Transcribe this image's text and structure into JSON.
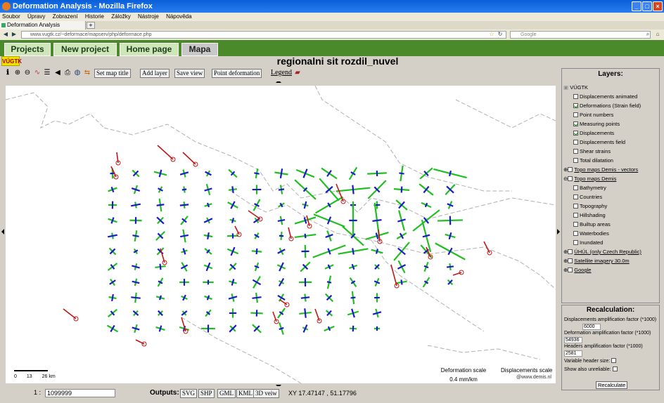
{
  "window": {
    "title": "Deformation Analysis - Mozilla Firefox"
  },
  "menu": [
    "Soubor",
    "Úpravy",
    "Zobrazení",
    "Historie",
    "Záložky",
    "Nástroje",
    "Nápověda"
  ],
  "browser_tab": {
    "label": "Deformation Analysis",
    "new_tab": "+"
  },
  "address": {
    "url": "www.vugtk.cz/~deformace/mapserv/php/deformace.php",
    "search_placeholder": "Google"
  },
  "nav": {
    "tabs": [
      "Projects",
      "New project",
      "Home page",
      "Mapa"
    ],
    "active": "Mapa"
  },
  "header": {
    "logo": "VÚGTK",
    "title": "regionalni sit rozdil_nuvel"
  },
  "toolbar": {
    "set_title": "Set map title",
    "add_layer": "Add layer",
    "save_view": "Save view",
    "point_deformation": "Point deformation",
    "legend": "Legend"
  },
  "map": {
    "scale_ticks": [
      "0",
      "13",
      "26 km"
    ],
    "deformation_scale_label": "Deformation scale",
    "deformation_scale_value": "0.4 mm/km",
    "displacements_scale_label": "Displacements scale",
    "copyright": "@www.demis.nl",
    "colors": {
      "strain_extension": "#1fbf1f",
      "strain_compression": "#1a1acc",
      "displacement": "#c01818",
      "border": "#b0b0b0"
    }
  },
  "layers": {
    "title": "Layers:",
    "root": "VÚGTK",
    "items": [
      {
        "label": "Displacements animated",
        "checked": false
      },
      {
        "label": "Deformations (Strain field)",
        "checked": true
      },
      {
        "label": "Point numbers",
        "checked": false
      },
      {
        "label": "Measuring points",
        "checked": true
      },
      {
        "label": "Displacements",
        "checked": true
      },
      {
        "label": "Displacements field",
        "checked": false
      },
      {
        "label": "Shear strains",
        "checked": false
      },
      {
        "label": "Total dilatation",
        "checked": false
      }
    ],
    "topo_vectors": "Topo maps Demis - vectors",
    "topo": "Topo maps Demis",
    "topo_items": [
      "Bathymetry",
      "Countries",
      "Topography",
      "Hillshading",
      "Builtup areas",
      "Waterbodies",
      "Inundated"
    ],
    "uhul": "ÚHÚL (only Czech Republic)",
    "satellite": "Satellite imagery 30.0m",
    "google": "Google"
  },
  "recalc": {
    "title": "Recalculation:",
    "disp_label": "Displacements amplification factor (*1000)",
    "disp_value": "6000",
    "def_label": "Deformation amplification factor (*1000)",
    "def_value": "54936",
    "head_label": "Headers amplification factor (*1000)",
    "head_value": "2581",
    "variable_header": "Variable header size:",
    "show_unreliable": "Show also unreliable:",
    "button": "Recalculate"
  },
  "status": {
    "scale_prefix": "1 :",
    "scale_value": "1099999",
    "outputs_label": "Outputs:",
    "outputs": [
      "SVG",
      "SHP",
      "GML",
      "KML",
      "3D veiw"
    ],
    "coords": "XY 17.47147 , 51.17796"
  }
}
